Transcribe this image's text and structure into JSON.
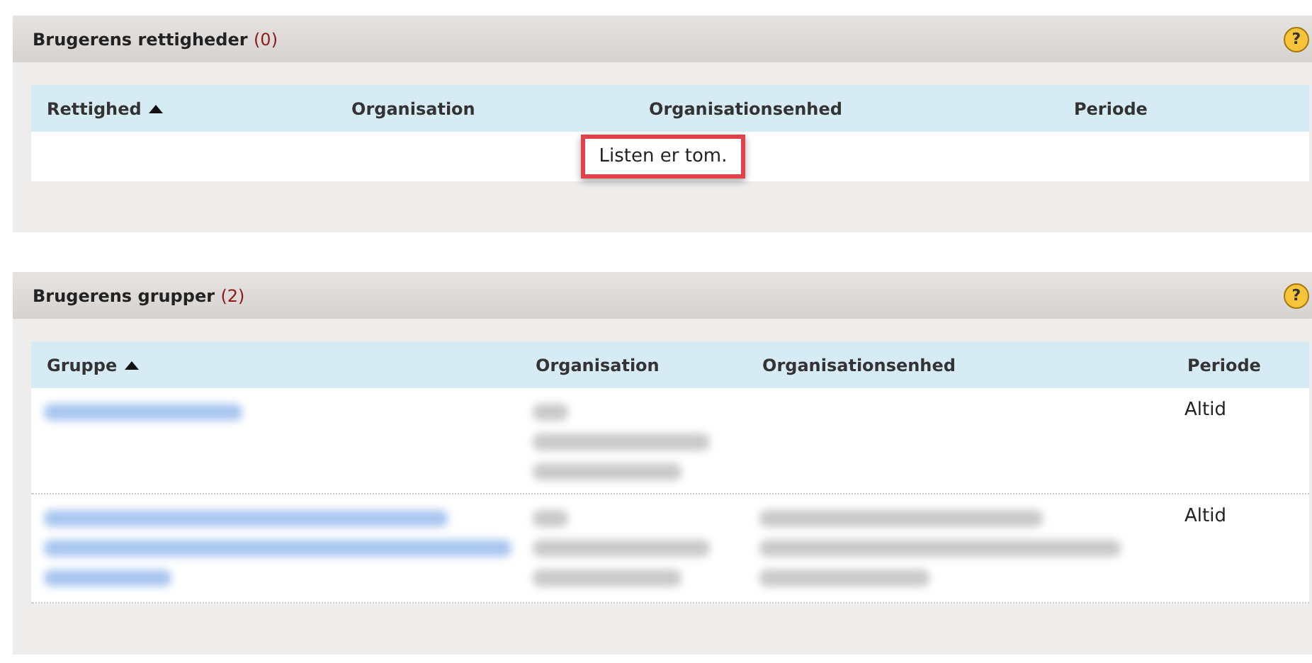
{
  "panels": [
    {
      "title": "Brugerens rettigheder",
      "count": "(0)",
      "help": "?",
      "columns": [
        {
          "label": "Rettighed",
          "sorted": true
        },
        {
          "label": "Organisation",
          "sorted": false
        },
        {
          "label": "Organisationsenhed",
          "sorted": false
        },
        {
          "label": "Periode",
          "sorted": false
        }
      ],
      "empty_message": "Listen er tom.",
      "empty_highlighted": true
    },
    {
      "title": "Brugerens grupper",
      "count": "(2)",
      "help": "?",
      "columns": [
        {
          "label": "Gruppe",
          "sorted": true
        },
        {
          "label": "Organisation",
          "sorted": false
        },
        {
          "label": "Organisationsenhed",
          "sorted": false
        },
        {
          "label": "Periode",
          "sorted": false
        }
      ],
      "rows": [
        {
          "unit_redacted": false,
          "periode": "Altid"
        },
        {
          "unit_redacted": true,
          "periode": "Altid"
        }
      ]
    }
  ]
}
